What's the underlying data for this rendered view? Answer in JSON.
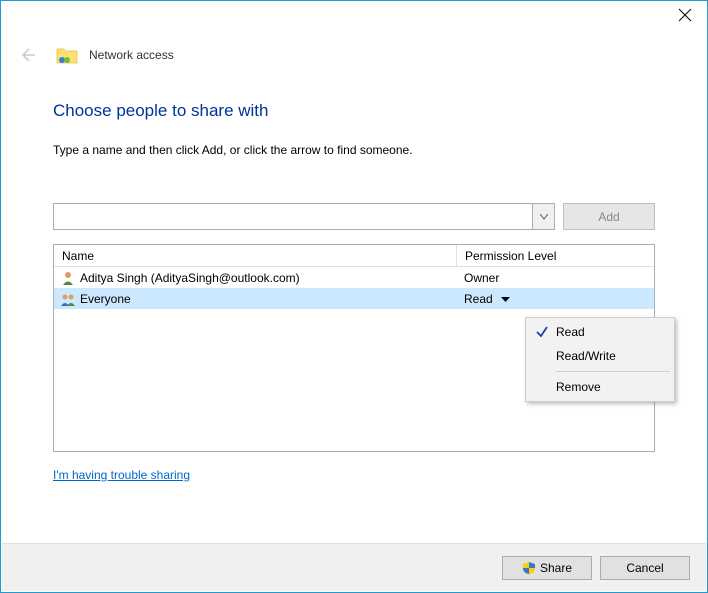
{
  "header": {
    "title": "Network access"
  },
  "heading": "Choose people to share with",
  "instruction": "Type a name and then click Add, or click the arrow to find someone.",
  "add_row": {
    "input_value": "",
    "add_label": "Add"
  },
  "grid": {
    "columns": {
      "name": "Name",
      "permission": "Permission Level"
    },
    "rows": [
      {
        "name": "Aditya Singh (AdityaSingh@outlook.com)",
        "permission": "Owner",
        "selected": false,
        "icon": "user"
      },
      {
        "name": "Everyone",
        "permission": "Read",
        "selected": true,
        "icon": "group"
      }
    ]
  },
  "perm_menu": {
    "read": "Read",
    "readwrite": "Read/Write",
    "remove": "Remove",
    "checked": "read"
  },
  "trouble_link": "I'm having trouble sharing",
  "footer": {
    "share": "Share",
    "cancel": "Cancel"
  }
}
